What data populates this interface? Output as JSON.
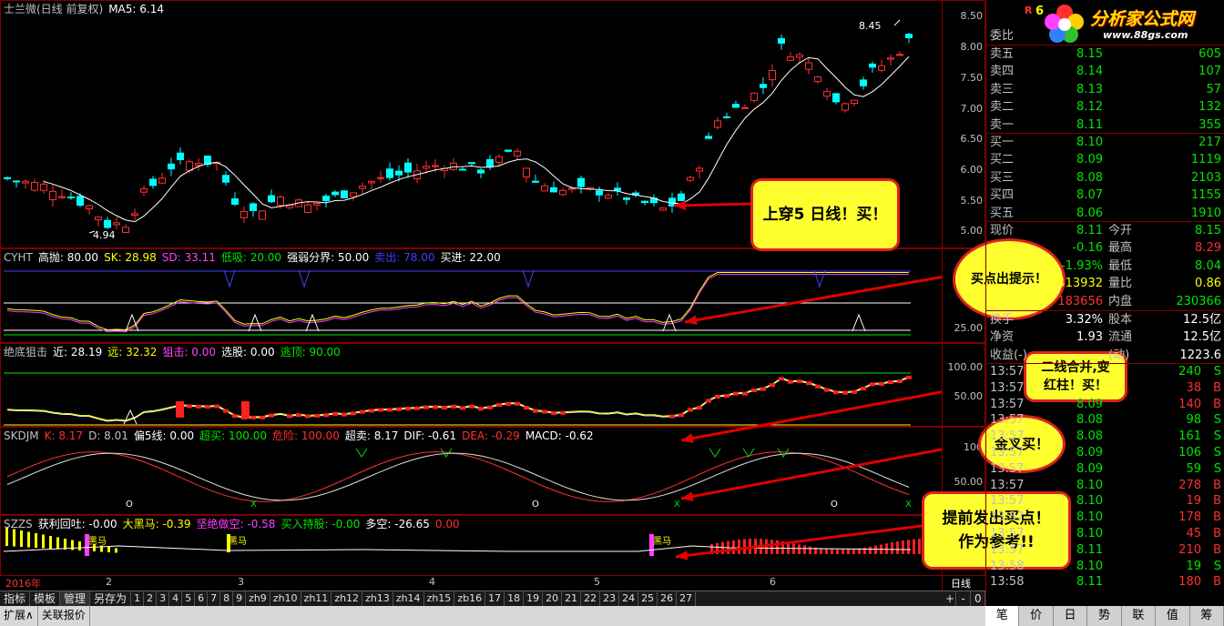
{
  "main_header": {
    "stock": "士兰微(日线 前复权)",
    "ma": "MA5: 6.14"
  },
  "main_y_ticks": [
    "8.50",
    "8.00",
    "7.50",
    "7.00",
    "6.50",
    "6.00",
    "5.50",
    "5.00"
  ],
  "price_labels": {
    "high": "8.45",
    "low": "4.94"
  },
  "cyht_header": [
    {
      "t": "CYHT",
      "c": "#c0c0c0"
    },
    {
      "t": "高抛: 80.00",
      "c": "#ffffff"
    },
    {
      "t": "SK: 28.98",
      "c": "#ffff00"
    },
    {
      "t": "SD: 33.11",
      "c": "#ff40ff"
    },
    {
      "t": "低吸: 20.00",
      "c": "#00e600"
    },
    {
      "t": "强弱分界: 50.00",
      "c": "#ffffff"
    },
    {
      "t": "卖出: 78.00",
      "c": "#4040ff"
    },
    {
      "t": "买进: 22.00",
      "c": "#ffffff"
    }
  ],
  "cyht_y_ticks": [
    "25.00"
  ],
  "jd_header": [
    {
      "t": "绝底狙击",
      "c": "#c0c0c0"
    },
    {
      "t": "近: 28.19",
      "c": "#ffffff"
    },
    {
      "t": "远: 32.32",
      "c": "#ffff00"
    },
    {
      "t": "狙击: 0.00",
      "c": "#ff40ff"
    },
    {
      "t": "选股: 0.00",
      "c": "#ffffff"
    },
    {
      "t": "逃顶: 90.00",
      "c": "#00e600"
    }
  ],
  "jd_y_ticks": [
    "100.00",
    "50.00"
  ],
  "sk_header": [
    {
      "t": "SKDJM",
      "c": "#c0c0c0"
    },
    {
      "t": "K: 8.17",
      "c": "#ff3030"
    },
    {
      "t": "D: 8.01",
      "c": "#c0c0c0"
    },
    {
      "t": "偏5线: 0.00",
      "c": "#ffffff"
    },
    {
      "t": "超买: 100.00",
      "c": "#00e600"
    },
    {
      "t": "危险: 100.00",
      "c": "#ff3030"
    },
    {
      "t": "超卖: 8.17",
      "c": "#ffffff"
    },
    {
      "t": "DIF: -0.61",
      "c": "#ffffff"
    },
    {
      "t": "DEA: -0.29",
      "c": "#ff3030"
    },
    {
      "t": "MACD: -0.62",
      "c": "#ffffff"
    }
  ],
  "sk_y_ticks": [
    "100",
    "50.00"
  ],
  "sk_marks": [
    "O",
    "X",
    "O",
    "X",
    "O",
    "X",
    "O"
  ],
  "szzs_header": [
    {
      "t": "SZZS",
      "c": "#c0c0c0"
    },
    {
      "t": "获利回吐: -0.00",
      "c": "#ffffff"
    },
    {
      "t": "大黑马: -0.39",
      "c": "#ffff00"
    },
    {
      "t": "坚绝做空: -0.58",
      "c": "#ff40ff"
    },
    {
      "t": "买入持股: -0.00",
      "c": "#00e600"
    },
    {
      "t": "多空: -26.65",
      "c": "#ffffff"
    },
    {
      "t": "0.00",
      "c": "#ff3030"
    }
  ],
  "szzs_label": "黑马",
  "x_axis": [
    "2016年",
    "2",
    "3",
    "4",
    "5",
    "6"
  ],
  "period": "日线",
  "tabs": [
    "指标",
    "模板",
    "管理",
    "另存为",
    "1",
    "2",
    "3",
    "4",
    "5",
    "6",
    "7",
    "8",
    "9",
    "zh9",
    "zh10",
    "zh11",
    "zh12",
    "zh13",
    "zh14",
    "zh15",
    "zb16",
    "17",
    "18",
    "19",
    "20",
    "21",
    "22",
    "23",
    "24",
    "25",
    "26",
    "27"
  ],
  "tab_right": [
    "+",
    "-",
    "0"
  ],
  "bottom_tabs": [
    "扩展∧",
    "关联报价"
  ],
  "right_tabs": [
    "笔",
    "价",
    "日",
    "势",
    "联",
    "值",
    "筹"
  ],
  "logo": {
    "title": "分析家公式网",
    "url": "www.88gs.com"
  },
  "weibi": {
    "label": "委比"
  },
  "sell": [
    {
      "label": "卖五",
      "price": "8.15",
      "vol": "605"
    },
    {
      "label": "卖四",
      "price": "8.14",
      "vol": "107"
    },
    {
      "label": "卖三",
      "price": "8.13",
      "vol": "57"
    },
    {
      "label": "卖二",
      "price": "8.12",
      "vol": "132"
    },
    {
      "label": "卖一",
      "price": "8.11",
      "vol": "355"
    }
  ],
  "buy": [
    {
      "label": "买一",
      "price": "8.10",
      "vol": "217"
    },
    {
      "label": "买二",
      "price": "8.09",
      "vol": "1119"
    },
    {
      "label": "买三",
      "price": "8.08",
      "vol": "2103"
    },
    {
      "label": "买四",
      "price": "8.07",
      "vol": "1155"
    },
    {
      "label": "买五",
      "price": "8.06",
      "vol": "1910"
    }
  ],
  "quote": [
    {
      "l": "现价",
      "v": "8.11",
      "vc": "#00e600",
      "l2": "今开",
      "v2": "8.15",
      "v2c": "#00e600"
    },
    {
      "l": "",
      "v": "-0.16",
      "vc": "#00e600",
      "l2": "最高",
      "v2": "8.29",
      "v2c": "#ff3030"
    },
    {
      "l": "",
      "v": "-1.93%",
      "vc": "#00e600",
      "l2": "最低",
      "v2": "8.04",
      "v2c": "#00e600"
    },
    {
      "l": "",
      "v": "413932",
      "vc": "#ffff00",
      "l2": "量比",
      "v2": "0.86",
      "v2c": "#ffff00"
    },
    {
      "l": "",
      "v": "183656",
      "vc": "#ff3030",
      "l2": "内盘",
      "v2": "230366",
      "v2c": "#00e600"
    }
  ],
  "info": [
    {
      "l": "换手",
      "v": "3.32%",
      "l2": "股本",
      "v2": "12.5亿"
    },
    {
      "l": "净资",
      "v": "1.93",
      "l2": "流通",
      "v2": "12.5亿"
    },
    {
      "l": "收益(-)",
      "v": "",
      "l2": "(动)",
      "v2": "1223.6"
    }
  ],
  "ticks": [
    {
      "t": "13:57",
      "p": "",
      "v": "240",
      "s": "S"
    },
    {
      "t": "13:57",
      "p": "",
      "v": "38",
      "s": "B"
    },
    {
      "t": "13:57",
      "p": "8.09",
      "v": "140",
      "s": "B"
    },
    {
      "t": "13:57",
      "p": "8.08",
      "v": "98",
      "s": "S"
    },
    {
      "t": "13:57",
      "p": "8.08",
      "v": "161",
      "s": "S"
    },
    {
      "t": "13:57",
      "p": "8.09",
      "v": "106",
      "s": "S"
    },
    {
      "t": "13:57",
      "p": "8.09",
      "v": "59",
      "s": "S"
    },
    {
      "t": "13:57",
      "p": "8.10",
      "v": "278",
      "s": "B"
    },
    {
      "t": "13:57",
      "p": "8.10",
      "v": "19",
      "s": "B"
    },
    {
      "t": "13:57",
      "p": "8.10",
      "v": "178",
      "s": "B"
    },
    {
      "t": "13:57",
      "p": "8.10",
      "v": "45",
      "s": "B"
    },
    {
      "t": "13:57",
      "p": "8.11",
      "v": "210",
      "s": "B"
    },
    {
      "t": "13:58",
      "p": "8.10",
      "v": "19",
      "s": "S"
    },
    {
      "t": "13:58",
      "p": "8.11",
      "v": "180",
      "s": "B"
    }
  ],
  "callouts": {
    "c1": "上穿5 日线！买！",
    "c2": "买点出提示！",
    "c3a": "二线合并,变",
    "c3b": "红柱！买！",
    "c4": "金叉买！",
    "c5a": "提前发出买点！",
    "c5b": "作为参考!!"
  }
}
